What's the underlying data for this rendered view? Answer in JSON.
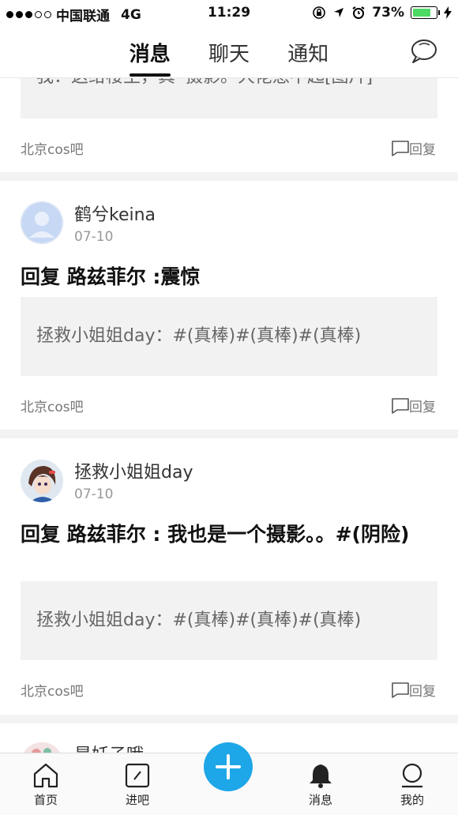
{
  "status_bar": {
    "carrier": "中国联通",
    "network": "4G",
    "time": "11:29",
    "battery": "73%"
  },
  "header": {
    "tabs": [
      {
        "label": "消息",
        "active": true
      },
      {
        "label": "聊天",
        "active": false
      },
      {
        "label": "通知",
        "active": false
      }
    ],
    "chat_icon": "speech-bubble-icon"
  },
  "feed": {
    "items": [
      {
        "quote": "我：这给楼主，真•摄影。大佬惹不起[图片]",
        "forum": "北京cos吧",
        "reply_label": "回复"
      },
      {
        "username": "鹤兮keina",
        "date": "07-10",
        "title": "回复 路兹菲尔 :震惊",
        "quote": "拯救小姐姐day：#(真棒)#(真棒)#(真棒)",
        "forum": "北京cos吧",
        "reply_label": "回复"
      },
      {
        "username": "拯救小姐姐day",
        "date": "07-10",
        "title": "回复 路兹菲尔 : 我也是一个摄影。。#(阴险)",
        "quote": "拯救小姐姐day：#(真棒)#(真棒)#(真棒)",
        "forum": "北京cos吧",
        "reply_label": "回复"
      },
      {
        "username": "是妖子哦"
      }
    ]
  },
  "bottom_nav": {
    "items": [
      {
        "label": "首页",
        "icon": "home-icon"
      },
      {
        "label": "进吧",
        "icon": "enter-forum-icon"
      },
      {
        "label": "",
        "icon": "plus-icon"
      },
      {
        "label": "消息",
        "icon": "bell-icon"
      },
      {
        "label": "我的",
        "icon": "profile-icon"
      }
    ]
  },
  "colors": {
    "accent": "#1ea7e8",
    "battery": "#4cd964"
  }
}
